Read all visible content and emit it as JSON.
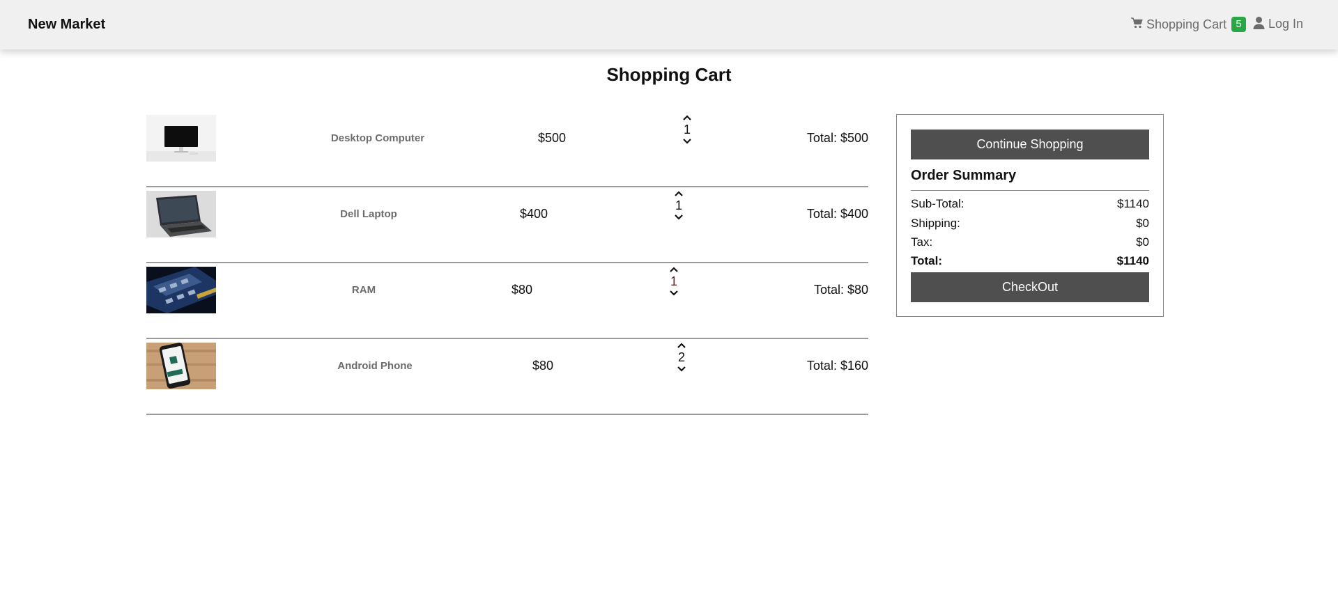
{
  "navbar": {
    "brand": "New Market",
    "cart_label": "Shopping Cart",
    "cart_count": "5",
    "login_label": "Log In",
    "badge_color": "#28a745"
  },
  "page": {
    "title": "Shopping Cart"
  },
  "cart": {
    "items": [
      {
        "name": "Desktop Computer",
        "price": "$500",
        "quantity": "1",
        "total": "Total: $500",
        "image": "desktop-computer-image"
      },
      {
        "name": "Dell Laptop",
        "price": "$400",
        "quantity": "1",
        "total": "Total: $400",
        "image": "laptop-image"
      },
      {
        "name": "RAM",
        "price": "$80",
        "quantity": "1",
        "total": "Total: $80",
        "image": "ram-module-image"
      },
      {
        "name": "Android Phone",
        "price": "$80",
        "quantity": "2",
        "total": "Total: $160",
        "image": "android-phone-image"
      }
    ]
  },
  "summary": {
    "continue_label": "Continue Shopping",
    "title": "Order Summary",
    "subtotal_label": "Sub-Total:",
    "subtotal_value": "$1140",
    "shipping_label": "Shipping:",
    "shipping_value": "$0",
    "tax_label": "Tax:",
    "tax_value": "$0",
    "total_label": "Total:",
    "total_value": "$1140",
    "checkout_label": "CheckOut",
    "button_color": "#4f4f4f"
  }
}
